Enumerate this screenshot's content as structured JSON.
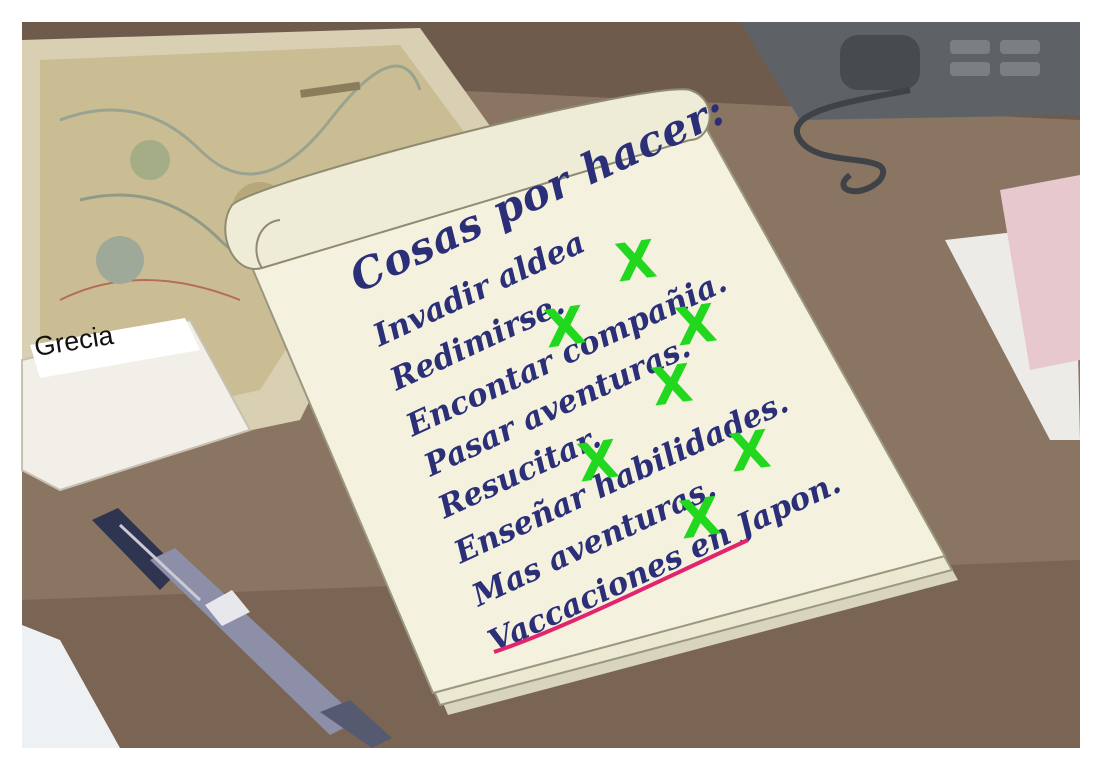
{
  "map": {
    "place_label": "Grecia"
  },
  "notepad": {
    "title": "Cosas por hacer:",
    "tasks": [
      {
        "label": "Invadir aldea",
        "checked": true,
        "struck": false
      },
      {
        "label": "Redimirse.",
        "checked": true,
        "struck": false
      },
      {
        "label": "Encontar compañia.",
        "checked": true,
        "struck": false
      },
      {
        "label": "Pasar aventuras.",
        "checked": true,
        "struck": false
      },
      {
        "label": "Resucitar.",
        "checked": true,
        "struck": false
      },
      {
        "label": "Enseñar habilidades.",
        "checked": true,
        "struck": false
      },
      {
        "label": "Mas aventuras.",
        "checked": true,
        "struck": false
      },
      {
        "label": "Vaccaciones en Japon.",
        "checked": false,
        "struck": true
      }
    ],
    "check_mark": "X",
    "check_color": "#22d81e",
    "ink_color": "#2b2f78",
    "strike_color": "#e0246e"
  }
}
